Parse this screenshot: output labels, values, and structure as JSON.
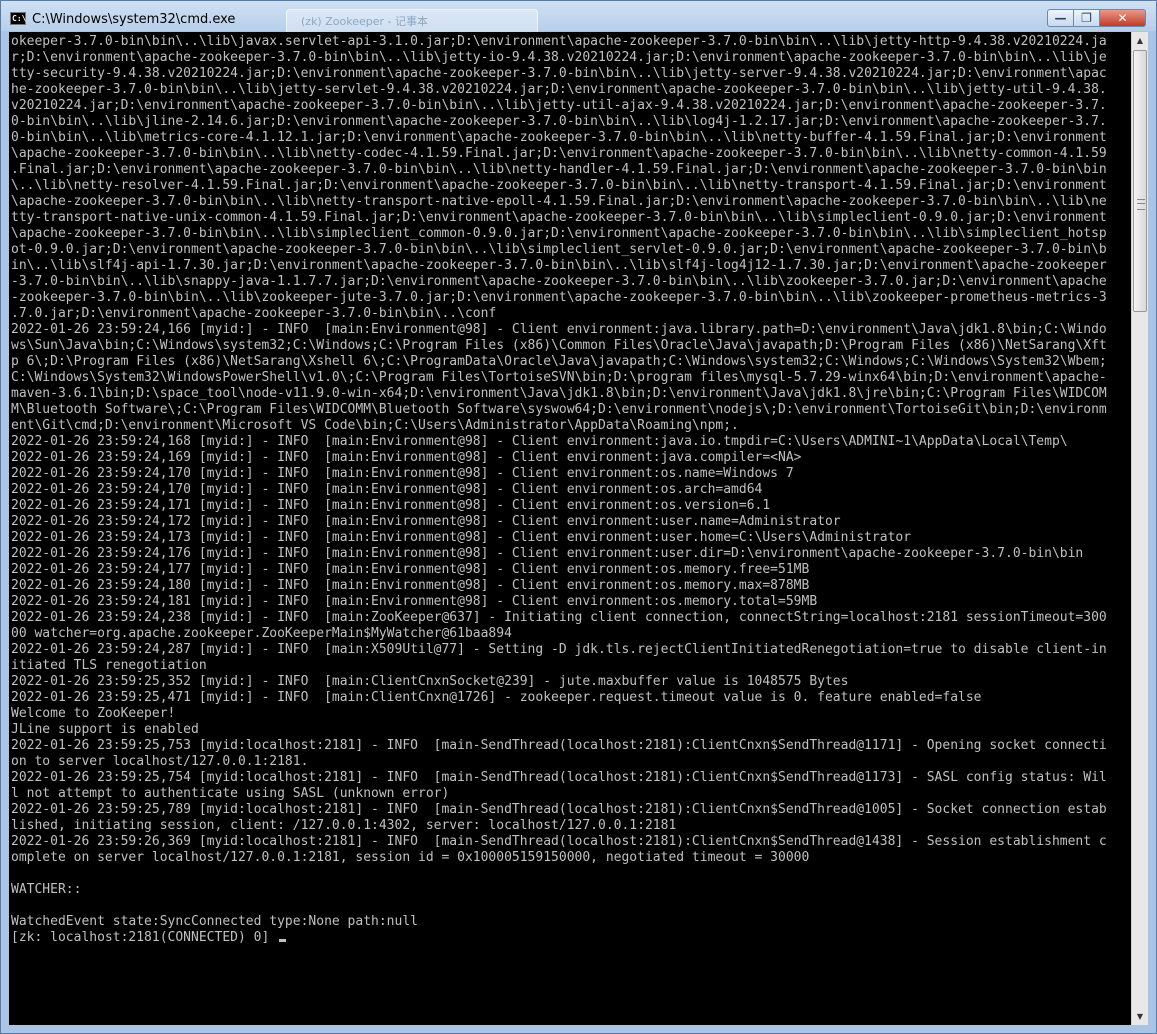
{
  "window": {
    "title": "C:\\Windows\\system32\\cmd.exe",
    "app_icon_text": "C:\\",
    "background_tab_title": "(zk) Zookeeper - 记事本"
  },
  "controls": {
    "minimize": "—",
    "maximize": "❐",
    "close": "✕"
  },
  "scrollbar": {
    "up_arrow": "▲",
    "down_arrow": "▼"
  },
  "console": {
    "lines": [
      "okeeper-3.7.0-bin\\bin\\..\\lib\\javax.servlet-api-3.1.0.jar;D:\\environment\\apache-zookeeper-3.7.0-bin\\bin\\..\\lib\\jetty-http-9.4.38.v20210224.ja",
      "r;D:\\environment\\apache-zookeeper-3.7.0-bin\\bin\\..\\lib\\jetty-io-9.4.38.v20210224.jar;D:\\environment\\apache-zookeeper-3.7.0-bin\\bin\\..\\lib\\je",
      "tty-security-9.4.38.v20210224.jar;D:\\environment\\apache-zookeeper-3.7.0-bin\\bin\\..\\lib\\jetty-server-9.4.38.v20210224.jar;D:\\environment\\apac",
      "he-zookeeper-3.7.0-bin\\bin\\..\\lib\\jetty-servlet-9.4.38.v20210224.jar;D:\\environment\\apache-zookeeper-3.7.0-bin\\bin\\..\\lib\\jetty-util-9.4.38.",
      "v20210224.jar;D:\\environment\\apache-zookeeper-3.7.0-bin\\bin\\..\\lib\\jetty-util-ajax-9.4.38.v20210224.jar;D:\\environment\\apache-zookeeper-3.7.",
      "0-bin\\bin\\..\\lib\\jline-2.14.6.jar;D:\\environment\\apache-zookeeper-3.7.0-bin\\bin\\..\\lib\\log4j-1.2.17.jar;D:\\environment\\apache-zookeeper-3.7.",
      "0-bin\\bin\\..\\lib\\metrics-core-4.1.12.1.jar;D:\\environment\\apache-zookeeper-3.7.0-bin\\bin\\..\\lib\\netty-buffer-4.1.59.Final.jar;D:\\environment",
      "\\apache-zookeeper-3.7.0-bin\\bin\\..\\lib\\netty-codec-4.1.59.Final.jar;D:\\environment\\apache-zookeeper-3.7.0-bin\\bin\\..\\lib\\netty-common-4.1.59",
      ".Final.jar;D:\\environment\\apache-zookeeper-3.7.0-bin\\bin\\..\\lib\\netty-handler-4.1.59.Final.jar;D:\\environment\\apache-zookeeper-3.7.0-bin\\bin",
      "\\..\\lib\\netty-resolver-4.1.59.Final.jar;D:\\environment\\apache-zookeeper-3.7.0-bin\\bin\\..\\lib\\netty-transport-4.1.59.Final.jar;D:\\environment",
      "\\apache-zookeeper-3.7.0-bin\\bin\\..\\lib\\netty-transport-native-epoll-4.1.59.Final.jar;D:\\environment\\apache-zookeeper-3.7.0-bin\\bin\\..\\lib\\ne",
      "tty-transport-native-unix-common-4.1.59.Final.jar;D:\\environment\\apache-zookeeper-3.7.0-bin\\bin\\..\\lib\\simpleclient-0.9.0.jar;D:\\environment",
      "\\apache-zookeeper-3.7.0-bin\\bin\\..\\lib\\simpleclient_common-0.9.0.jar;D:\\environment\\apache-zookeeper-3.7.0-bin\\bin\\..\\lib\\simpleclient_hotsp",
      "ot-0.9.0.jar;D:\\environment\\apache-zookeeper-3.7.0-bin\\bin\\..\\lib\\simpleclient_servlet-0.9.0.jar;D:\\environment\\apache-zookeeper-3.7.0-bin\\b",
      "in\\..\\lib\\slf4j-api-1.7.30.jar;D:\\environment\\apache-zookeeper-3.7.0-bin\\bin\\..\\lib\\slf4j-log4j12-1.7.30.jar;D:\\environment\\apache-zookeeper",
      "-3.7.0-bin\\bin\\..\\lib\\snappy-java-1.1.7.7.jar;D:\\environment\\apache-zookeeper-3.7.0-bin\\bin\\..\\lib\\zookeeper-3.7.0.jar;D:\\environment\\apache",
      "-zookeeper-3.7.0-bin\\bin\\..\\lib\\zookeeper-jute-3.7.0.jar;D:\\environment\\apache-zookeeper-3.7.0-bin\\bin\\..\\lib\\zookeeper-prometheus-metrics-3",
      ".7.0.jar;D:\\environment\\apache-zookeeper-3.7.0-bin\\bin\\..\\conf",
      "2022-01-26 23:59:24,166 [myid:] - INFO  [main:Environment@98] - Client environment:java.library.path=D:\\environment\\Java\\jdk1.8\\bin;C:\\Windo",
      "ws\\Sun\\Java\\bin;C:\\Windows\\system32;C:\\Windows;C:\\Program Files (x86)\\Common Files\\Oracle\\Java\\javapath;D:\\Program Files (x86)\\NetSarang\\Xft",
      "p 6\\;D:\\Program Files (x86)\\NetSarang\\Xshell 6\\;C:\\ProgramData\\Oracle\\Java\\javapath;C:\\Windows\\system32;C:\\Windows;C:\\Windows\\System32\\Wbem;",
      "C:\\Windows\\System32\\WindowsPowerShell\\v1.0\\;C:\\Program Files\\TortoiseSVN\\bin;D:\\program files\\mysql-5.7.29-winx64\\bin;D:\\environment\\apache-",
      "maven-3.6.1\\bin;D:\\space_tool\\node-v11.9.0-win-x64;D:\\environment\\Java\\jdk1.8\\bin;D:\\environment\\Java\\jdk1.8\\jre\\bin;C:\\Program Files\\WIDCOM",
      "M\\Bluetooth Software\\;C:\\Program Files\\WIDCOMM\\Bluetooth Software\\syswow64;D:\\environment\\nodejs\\;D:\\environment\\TortoiseGit\\bin;D:\\environm",
      "ent\\Git\\cmd;D:\\environment\\Microsoft VS Code\\bin;C:\\Users\\Administrator\\AppData\\Roaming\\npm;.",
      "2022-01-26 23:59:24,168 [myid:] - INFO  [main:Environment@98] - Client environment:java.io.tmpdir=C:\\Users\\ADMINI~1\\AppData\\Local\\Temp\\",
      "2022-01-26 23:59:24,169 [myid:] - INFO  [main:Environment@98] - Client environment:java.compiler=<NA>",
      "2022-01-26 23:59:24,170 [myid:] - INFO  [main:Environment@98] - Client environment:os.name=Windows 7",
      "2022-01-26 23:59:24,170 [myid:] - INFO  [main:Environment@98] - Client environment:os.arch=amd64",
      "2022-01-26 23:59:24,171 [myid:] - INFO  [main:Environment@98] - Client environment:os.version=6.1",
      "2022-01-26 23:59:24,172 [myid:] - INFO  [main:Environment@98] - Client environment:user.name=Administrator",
      "2022-01-26 23:59:24,173 [myid:] - INFO  [main:Environment@98] - Client environment:user.home=C:\\Users\\Administrator",
      "2022-01-26 23:59:24,176 [myid:] - INFO  [main:Environment@98] - Client environment:user.dir=D:\\environment\\apache-zookeeper-3.7.0-bin\\bin",
      "2022-01-26 23:59:24,177 [myid:] - INFO  [main:Environment@98] - Client environment:os.memory.free=51MB",
      "2022-01-26 23:59:24,180 [myid:] - INFO  [main:Environment@98] - Client environment:os.memory.max=878MB",
      "2022-01-26 23:59:24,181 [myid:] - INFO  [main:Environment@98] - Client environment:os.memory.total=59MB",
      "2022-01-26 23:59:24,238 [myid:] - INFO  [main:ZooKeeper@637] - Initiating client connection, connectString=localhost:2181 sessionTimeout=300",
      "00 watcher=org.apache.zookeeper.ZooKeeperMain$MyWatcher@61baa894",
      "2022-01-26 23:59:24,287 [myid:] - INFO  [main:X509Util@77] - Setting -D jdk.tls.rejectClientInitiatedRenegotiation=true to disable client-in",
      "itiated TLS renegotiation",
      "2022-01-26 23:59:25,352 [myid:] - INFO  [main:ClientCnxnSocket@239] - jute.maxbuffer value is 1048575 Bytes",
      "2022-01-26 23:59:25,471 [myid:] - INFO  [main:ClientCnxn@1726] - zookeeper.request.timeout value is 0. feature enabled=false",
      "Welcome to ZooKeeper!",
      "JLine support is enabled",
      "2022-01-26 23:59:25,753 [myid:localhost:2181] - INFO  [main-SendThread(localhost:2181):ClientCnxn$SendThread@1171] - Opening socket connecti",
      "on to server localhost/127.0.0.1:2181.",
      "2022-01-26 23:59:25,754 [myid:localhost:2181] - INFO  [main-SendThread(localhost:2181):ClientCnxn$SendThread@1173] - SASL config status: Wil",
      "l not attempt to authenticate using SASL (unknown error)",
      "2022-01-26 23:59:25,789 [myid:localhost:2181] - INFO  [main-SendThread(localhost:2181):ClientCnxn$SendThread@1005] - Socket connection estab",
      "lished, initiating session, client: /127.0.0.1:4302, server: localhost/127.0.0.1:2181",
      "2022-01-26 23:59:26,369 [myid:localhost:2181] - INFO  [main-SendThread(localhost:2181):ClientCnxn$SendThread@1438] - Session establishment c",
      "omplete on server localhost/127.0.0.1:2181, session id = 0x100005159150000, negotiated timeout = 30000",
      "",
      "WATCHER::",
      "",
      "WatchedEvent state:SyncConnected type:None path:null"
    ],
    "prompt": "[zk: localhost:2181(CONNECTED) 0] "
  }
}
